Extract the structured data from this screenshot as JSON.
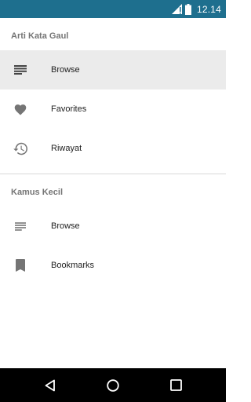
{
  "status_bar": {
    "time": "12.14",
    "icons": [
      "signal-icon",
      "battery-icon"
    ]
  },
  "sections": [
    {
      "header": "Arti Kata Gaul",
      "items": [
        {
          "label": "Browse",
          "icon": "list-icon",
          "selected": true
        },
        {
          "label": "Favorites",
          "icon": "heart-icon",
          "selected": false
        },
        {
          "label": "Riwayat",
          "icon": "history-icon",
          "selected": false
        }
      ]
    },
    {
      "header": "Kamus Kecil",
      "items": [
        {
          "label": "Browse",
          "icon": "list-icon",
          "selected": false
        },
        {
          "label": "Bookmarks",
          "icon": "bookmark-icon",
          "selected": false
        }
      ]
    }
  ],
  "nav_bar": {
    "icons": [
      "back-icon",
      "home-icon",
      "recents-icon"
    ]
  },
  "colors": {
    "status_bar": "#1e6f8e",
    "selected_row": "#ebebeb",
    "icon": "#757575",
    "nav_bar": "#000000"
  }
}
